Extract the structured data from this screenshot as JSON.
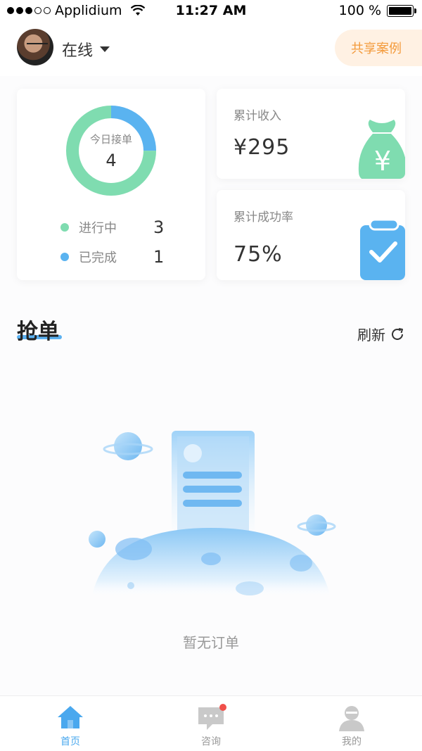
{
  "status_bar": {
    "carrier": "Applidium",
    "time": "11:27 AM",
    "battery": "100 %"
  },
  "header": {
    "status_label": "在线",
    "share_button": "共享案例"
  },
  "orders_card": {
    "center_label": "今日接单",
    "center_value": "4",
    "in_progress_label": "进行中",
    "in_progress_value": "3",
    "completed_label": "已完成",
    "completed_value": "1",
    "colors": {
      "in_progress": "#7fdcb0",
      "completed": "#5ab3f0"
    }
  },
  "chart_data": {
    "type": "pie",
    "categories": [
      "进行中",
      "已完成"
    ],
    "values": [
      3,
      1
    ],
    "title": "今日接单"
  },
  "income_card": {
    "title": "累计收入",
    "value": "¥295",
    "icon": "money-bag-icon"
  },
  "rate_card": {
    "title": "累计成功率",
    "value": "75%",
    "icon": "clipboard-check-icon"
  },
  "section": {
    "title": "抢单",
    "refresh_label": "刷新"
  },
  "empty_state": {
    "text": "暂无订单"
  },
  "tabbar": {
    "items": [
      {
        "label": "首页",
        "icon": "home-icon",
        "active": true
      },
      {
        "label": "咨询",
        "icon": "chat-icon",
        "active": false
      },
      {
        "label": "我的",
        "icon": "user-icon",
        "active": false
      }
    ]
  },
  "colors": {
    "accent": "#4aa8ee",
    "share_bg": "#fff1e3",
    "share_text": "#f39a3b"
  }
}
